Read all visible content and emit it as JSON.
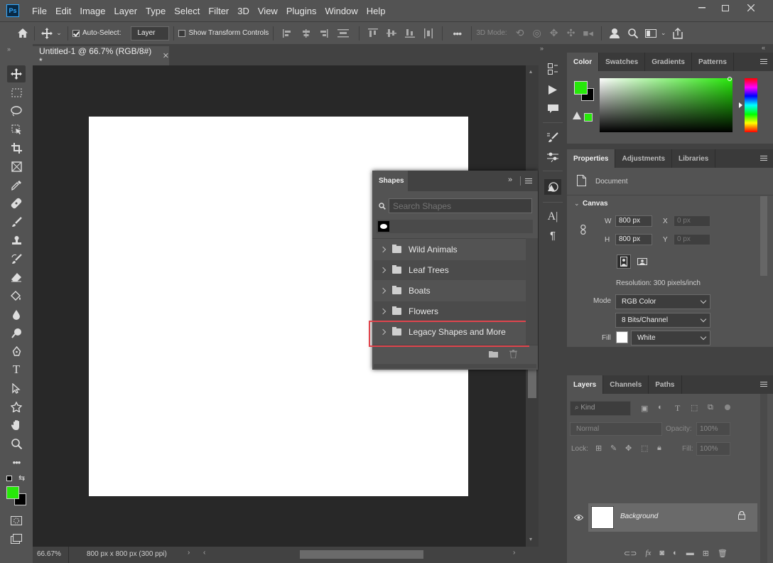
{
  "menubar": {
    "logo": "Ps",
    "items": [
      "File",
      "Edit",
      "Image",
      "Layer",
      "Type",
      "Select",
      "Filter",
      "3D",
      "View",
      "Plugins",
      "Window",
      "Help"
    ]
  },
  "options": {
    "auto_select_label": "Auto-Select:",
    "auto_select_value": "Layer",
    "transform_label": "Show Transform Controls",
    "mode_3d": "3D Mode:"
  },
  "document": {
    "tab_title": "Untitled-1 @ 66.7% (RGB/8#) *",
    "zoom": "66.67%",
    "info": "800 px x 800 px (300 ppi)"
  },
  "colors": {
    "foreground": "#27e80a",
    "background": "#000000",
    "canvas": "#ffffff"
  },
  "color_panel": {
    "tabs": [
      "Color",
      "Swatches",
      "Gradients",
      "Patterns"
    ]
  },
  "properties": {
    "tabs": [
      "Properties",
      "Adjustments",
      "Libraries"
    ],
    "doc_label": "Document",
    "section": "Canvas",
    "w_label": "W",
    "w_value": "800 px",
    "x_label": "X",
    "x_value": "0 px",
    "h_label": "H",
    "h_value": "800 px",
    "y_label": "Y",
    "y_value": "0 px",
    "resolution": "Resolution: 300 pixels/inch",
    "mode_label": "Mode",
    "mode_value": "RGB Color",
    "depth_value": "8 Bits/Channel",
    "fill_label": "Fill",
    "fill_value": "White"
  },
  "layers": {
    "tabs": [
      "Layers",
      "Channels",
      "Paths"
    ],
    "kind": "Kind",
    "blend": "Normal",
    "opacity_label": "Opacity:",
    "opacity_value": "100%",
    "lock_label": "Lock:",
    "fill_label": "Fill:",
    "fill_value": "100%",
    "layer_name": "Background"
  },
  "shapes": {
    "title": "Shapes",
    "search_placeholder": "Search Shapes",
    "groups": [
      "Wild Animals",
      "Leaf Trees",
      "Boats",
      "Flowers",
      "Legacy Shapes and More"
    ],
    "highlighted": "Legacy Shapes and More"
  }
}
